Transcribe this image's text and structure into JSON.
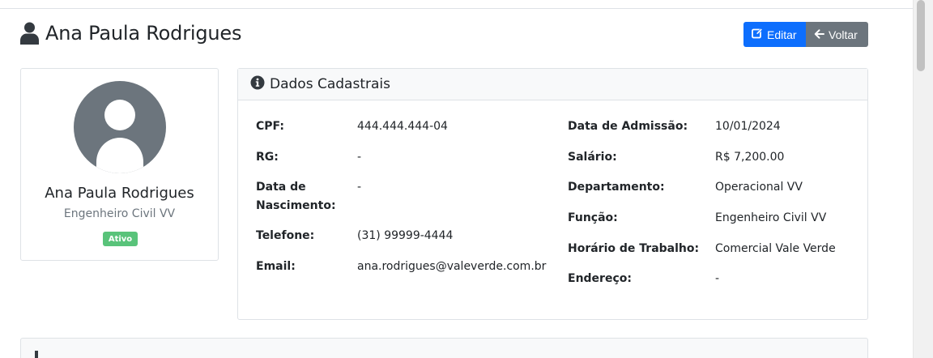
{
  "page": {
    "title": "Ana Paula Rodrigues",
    "title_icon": "user-icon"
  },
  "actions": {
    "edit_label": "Editar",
    "edit_icon": "edit-icon",
    "back_label": "Voltar",
    "back_icon": "arrow-left-icon"
  },
  "profile": {
    "name": "Ana Paula Rodrigues",
    "role": "Engenheiro Civil VV",
    "status": "Ativo",
    "avatar_icon": "user-avatar-icon"
  },
  "details": {
    "header": "Dados Cadastrais",
    "header_icon": "info-icon",
    "left": [
      {
        "label": "CPF:",
        "value": "444.444.444-04"
      },
      {
        "label": "RG:",
        "value": "-"
      },
      {
        "label": "Data de Nascimento:",
        "value": "-"
      },
      {
        "label": "Telefone:",
        "value": "(31) 99999-4444"
      },
      {
        "label": "Email:",
        "value": "ana.rodrigues@valeverde.com.br"
      }
    ],
    "right": [
      {
        "label": "Data de Admissão:",
        "value": "10/01/2024"
      },
      {
        "label": "Salário:",
        "value": "R$ 7,200.00"
      },
      {
        "label": "Departamento:",
        "value": "Operacional VV"
      },
      {
        "label": "Função:",
        "value": "Engenheiro Civil VV"
      },
      {
        "label": "Horário de Trabalho:",
        "value": "Comercial Vale Verde"
      },
      {
        "label": "Endereço:",
        "value": "-"
      }
    ]
  },
  "colors": {
    "primary": "#0d6efd",
    "secondary": "#6c757d",
    "success": "#59c37a"
  }
}
